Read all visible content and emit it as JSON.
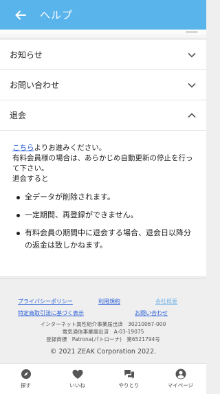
{
  "header": {
    "title": "ヘルプ"
  },
  "accordion": {
    "items": [
      {
        "label": "お知らせ",
        "expanded": false
      },
      {
        "label": "お問い合わせ",
        "expanded": false
      },
      {
        "label": "退会",
        "expanded": true
      }
    ]
  },
  "withdrawal": {
    "link_text": "こちら",
    "line1_rest": "よりお進みください。",
    "line2": "有料会員様の場合は、あらかじめ自動更新の停止を行って下さい。",
    "line3": "退会すると",
    "bullets": [
      "全データが削除されます。",
      "一定期間、再登録ができません。",
      "有料会員の期間中に退会する場合、退会日以降分の返金は致しかねます。"
    ]
  },
  "footer": {
    "links": {
      "privacy": "プライバシーポリシー",
      "terms": "利用規約",
      "company": "会社概要",
      "commerce": "特定商取引法に基づく表示",
      "contact": "お問い合わせ"
    },
    "registrations": [
      "インターネット異性紹介事業届出済　30210067-000",
      "電気通信事業届出済　A-03-19075",
      "登録商標　Patrona(パトローナ)　第6521794号"
    ],
    "copyright": "© 2021 ZEAK Corporation 2022."
  },
  "tabbar": {
    "items": [
      {
        "label": "探す",
        "icon": "compass-icon"
      },
      {
        "label": "いいね",
        "icon": "heart-icon"
      },
      {
        "label": "やりとり",
        "icon": "chat-icon"
      },
      {
        "label": "マイページ",
        "icon": "user-icon"
      }
    ]
  },
  "colors": {
    "header": "#5ab4ec",
    "link": "#2a5fd8",
    "link_light": "#7ab8e8"
  }
}
